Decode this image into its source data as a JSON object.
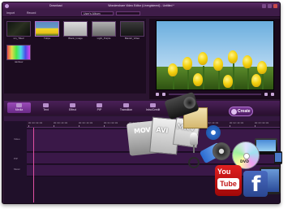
{
  "window": {
    "title": "Wondershare Video Editor (Unregistered) - Untitled *",
    "update_label": "Download"
  },
  "toolbar": {
    "import_label": "Import",
    "record_label": "Record",
    "album_select": "User's Album"
  },
  "library": {
    "clips": [
      {
        "caption": "sm_Titled",
        "thumb": "desk"
      },
      {
        "caption": "Tulips",
        "thumb": "flower",
        "selected": true
      },
      {
        "caption": "Blank_Image",
        "thumb": "blank"
      },
      {
        "caption": "Light_Purple",
        "thumb": "plain"
      },
      {
        "caption": "Blank2_Video",
        "thumb": "dark"
      },
      {
        "caption": "rainbow",
        "thumb": "rainbow"
      }
    ]
  },
  "tabs": [
    {
      "label": "Media",
      "active": true
    },
    {
      "label": "Text"
    },
    {
      "label": "Effect"
    },
    {
      "label": "PIP"
    },
    {
      "label": "Transition"
    },
    {
      "label": "Intro/Credit"
    },
    {
      "label": "Sound"
    }
  ],
  "create_button": {
    "label": "Create"
  },
  "timeline": {
    "tracks": [
      "Video",
      "PIP",
      "Music"
    ],
    "markers": [
      "00:00:00:00",
      "00:00:20:00",
      "00:00:40:00",
      "00:01:00:00",
      "00:01:20:00",
      "00:01:40:00",
      "00:02:00:00",
      "00:02:20:00",
      "00:02:40:00",
      "00:03:00:00"
    ]
  },
  "deco": {
    "film_format": "MOV",
    "doc_format": "AVI",
    "mkv_format": "MKV",
    "dvd_label": "DVD",
    "youtube_you": "You",
    "youtube_tube": "Tube",
    "facebook_letter": "f"
  },
  "colors": {
    "app_background": "#2a1430",
    "accent": "#9a4ab8",
    "playhead": "#e050a0"
  },
  "icons": [
    "app-logo-icon",
    "import-icon",
    "record-icon",
    "play-icon",
    "create-icon",
    "camera-icon",
    "dvd-icon",
    "tv-icon",
    "phone-icon",
    "tablet-icon",
    "youtube-icon",
    "facebook-icon",
    "scissors-icon",
    "microphone-icon",
    "film-reel-icon"
  ]
}
